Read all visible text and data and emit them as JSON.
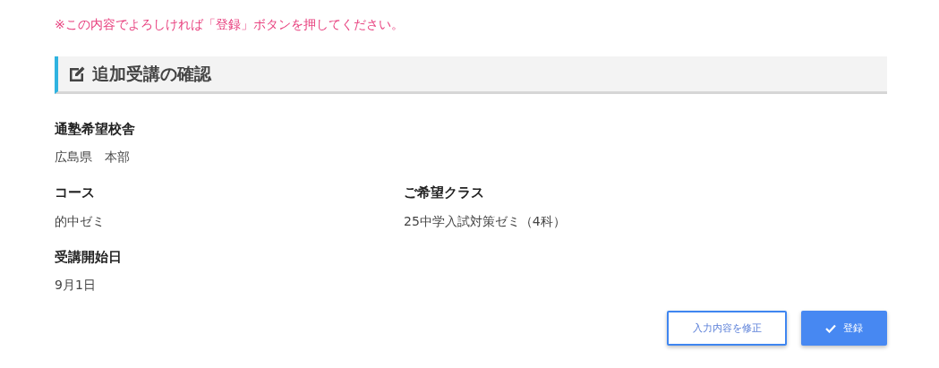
{
  "notice": "※この内容でよろしければ「登録」ボタンを押してください。",
  "section": {
    "title": "追加受講の確認"
  },
  "rows": [
    [
      {
        "label": "通塾希望校舎",
        "value": "広島県　本部"
      }
    ],
    [
      {
        "label": "コース",
        "value": "的中ゼミ"
      },
      {
        "label": "ご希望クラス",
        "value": "25中学入試対策ゼミ（4科）"
      }
    ],
    [
      {
        "label": "受講開始日",
        "value": "9月1日"
      }
    ]
  ],
  "buttons": [
    {
      "kind": "outline",
      "label": "入力内容を修正"
    },
    {
      "kind": "primary",
      "label": "登録"
    }
  ]
}
